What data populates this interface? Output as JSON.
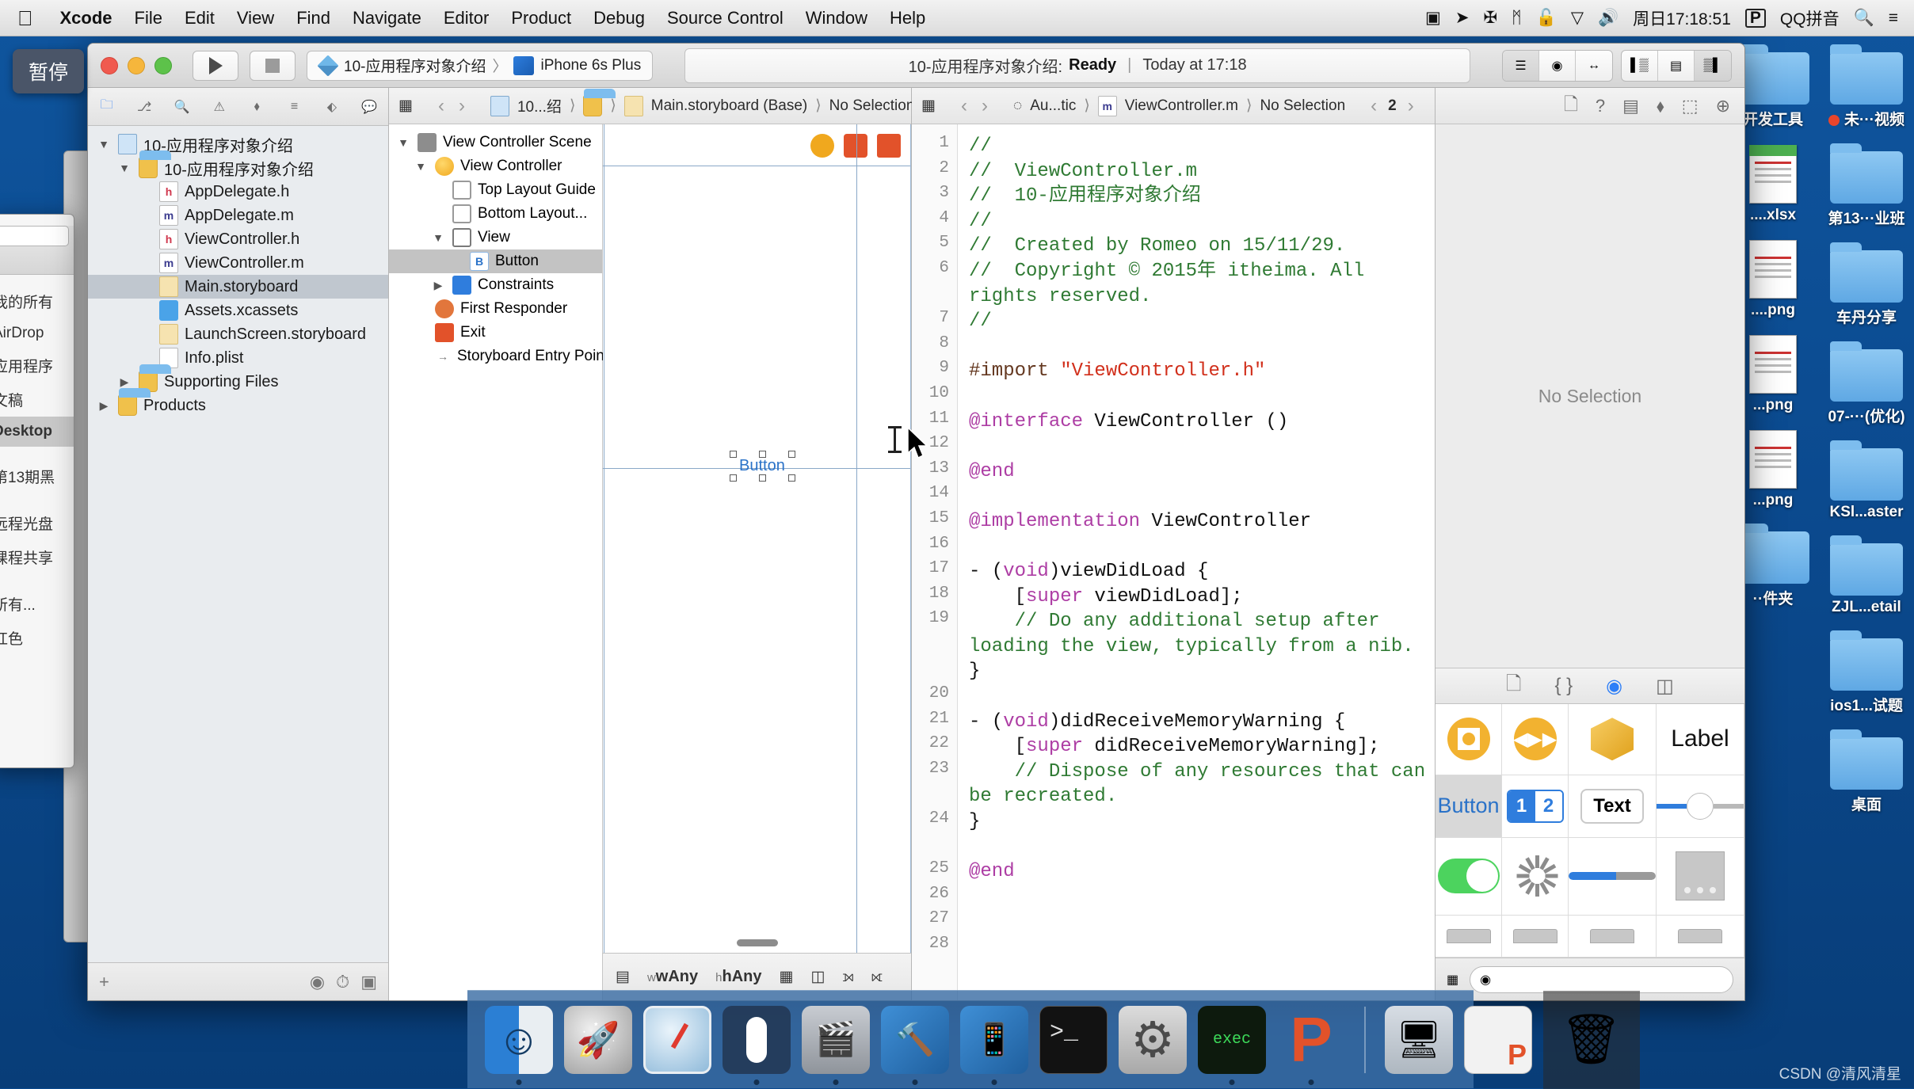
{
  "menubar": {
    "apple_icon": "apple-icon",
    "items": [
      {
        "label": "Xcode",
        "bold": true
      },
      {
        "label": "File",
        "bold": false
      },
      {
        "label": "Edit",
        "bold": false
      },
      {
        "label": "View",
        "bold": false
      },
      {
        "label": "Find",
        "bold": false
      },
      {
        "label": "Navigate",
        "bold": false
      },
      {
        "label": "Editor",
        "bold": false
      },
      {
        "label": "Product",
        "bold": false
      },
      {
        "label": "Debug",
        "bold": false
      },
      {
        "label": "Source Control",
        "bold": false
      },
      {
        "label": "Window",
        "bold": false
      },
      {
        "label": "Help",
        "bold": false
      }
    ],
    "status_items": [
      {
        "name": "screen-recording-icon",
        "glyph": "▣"
      },
      {
        "name": "location-arrow-icon",
        "glyph": "➤"
      },
      {
        "name": "airplay-icon",
        "glyph": "✠"
      },
      {
        "name": "bluetooth-icon",
        "glyph": "ᛗ"
      },
      {
        "name": "lock-icon",
        "glyph": "🔓"
      },
      {
        "name": "wifi-icon",
        "glyph": "▽"
      },
      {
        "name": "volume-icon",
        "glyph": "🔊"
      }
    ],
    "clock": "周日17:18:51",
    "input_badge": "P",
    "input_method": "QQ拼音",
    "spotlight_icon": "search-icon",
    "notification_icon": "list-icon"
  },
  "tooltip": {
    "text": "暂停"
  },
  "toolbar": {
    "run_icon": "play-icon",
    "stop_icon": "stop-icon",
    "scheme_name": "10-应用程序对象介绍",
    "scheme_sep": "〉",
    "destination": "iPhone 6s Plus",
    "status_project": "10-应用程序对象介绍:",
    "status_state": "Ready",
    "status_sep": "|",
    "status_time": "Today at 17:18"
  },
  "navigator": {
    "tabs": [
      {
        "name": "project-navigator-tab",
        "glyph": "🗀",
        "active": true
      },
      {
        "name": "source-control-navigator-tab",
        "glyph": "⎇",
        "active": false
      },
      {
        "name": "find-navigator-tab",
        "glyph": "🔍",
        "active": false
      },
      {
        "name": "issue-navigator-tab",
        "glyph": "⚠",
        "active": false
      },
      {
        "name": "test-navigator-tab",
        "glyph": "⬧",
        "active": false
      },
      {
        "name": "debug-navigator-tab",
        "glyph": "≡",
        "active": false
      },
      {
        "name": "breakpoint-navigator-tab",
        "glyph": "⬖",
        "active": false
      },
      {
        "name": "report-navigator-tab",
        "glyph": "💬",
        "active": false
      }
    ],
    "tree": [
      {
        "label": "10-应用程序对象介绍",
        "indent": 0,
        "twisty": "▼",
        "icon": "proj",
        "selected": false
      },
      {
        "label": "10-应用程序对象介绍",
        "indent": 1,
        "twisty": "▼",
        "icon": "folder",
        "selected": false
      },
      {
        "label": "AppDelegate.h",
        "indent": 2,
        "twisty": "",
        "icon": "h",
        "badge": "h",
        "selected": false
      },
      {
        "label": "AppDelegate.m",
        "indent": 2,
        "twisty": "",
        "icon": "m",
        "badge": "m",
        "selected": false
      },
      {
        "label": "ViewController.h",
        "indent": 2,
        "twisty": "",
        "icon": "h",
        "badge": "h",
        "selected": false
      },
      {
        "label": "ViewController.m",
        "indent": 2,
        "twisty": "",
        "icon": "m",
        "badge": "m",
        "selected": false
      },
      {
        "label": "Main.storyboard",
        "indent": 2,
        "twisty": "",
        "icon": "sb",
        "badge": "",
        "selected": true
      },
      {
        "label": "Assets.xcassets",
        "indent": 2,
        "twisty": "",
        "icon": "xcassets",
        "badge": "",
        "selected": false
      },
      {
        "label": "LaunchScreen.storyboard",
        "indent": 2,
        "twisty": "",
        "icon": "sb",
        "badge": "",
        "selected": false
      },
      {
        "label": "Info.plist",
        "indent": 2,
        "twisty": "",
        "icon": "plist",
        "badge": "",
        "selected": false
      },
      {
        "label": "Supporting Files",
        "indent": 1,
        "twisty": "▶",
        "icon": "folder",
        "selected": false
      },
      {
        "label": "Products",
        "indent": 0,
        "twisty": "▶",
        "icon": "folder",
        "selected": false
      }
    ],
    "footer_add": "+",
    "footer_filter_icon": "filter-icon"
  },
  "storyboard_editor": {
    "jumpbar": {
      "grid_icon": "grid-icon",
      "back": "‹",
      "forward": "›",
      "crumbs": [
        "10...绍",
        "",
        "Main.storyboard (Base)",
        "No Selection"
      ]
    },
    "outline": [
      {
        "label": "View Controller Scene",
        "indent": 0,
        "twisty": "▼",
        "icon": "scene",
        "selected": false
      },
      {
        "label": "View Controller",
        "indent": 1,
        "twisty": "▼",
        "icon": "vc",
        "selected": false
      },
      {
        "label": "Top Layout Guide",
        "indent": 2,
        "twisty": "",
        "icon": "guide",
        "selected": false
      },
      {
        "label": "Bottom Layout...",
        "indent": 2,
        "twisty": "",
        "icon": "guide",
        "selected": false
      },
      {
        "label": "View",
        "indent": 2,
        "twisty": "▼",
        "icon": "view",
        "selected": false
      },
      {
        "label": "Button",
        "indent": 3,
        "twisty": "",
        "icon": "btn",
        "selected": true
      },
      {
        "label": "Constraints",
        "indent": 2,
        "twisty": "▶",
        "icon": "cons",
        "selected": false
      },
      {
        "label": "First Responder",
        "indent": 1,
        "twisty": "",
        "icon": "fr",
        "selected": false
      },
      {
        "label": "Exit",
        "indent": 1,
        "twisty": "",
        "icon": "exit",
        "selected": false
      },
      {
        "label": "Storyboard Entry Point",
        "indent": 1,
        "twisty": "",
        "icon": "arrow",
        "selected": false
      }
    ],
    "canvas": {
      "button_label": "Button",
      "size_class_w": "wAny",
      "size_class_w_prefix": "w",
      "size_class_h": "hAny",
      "size_class_h_prefix": "h",
      "bottom_icons": [
        "panel-icon",
        "constraints-icon",
        "align-icon",
        "pin-icon",
        "resolve-icon"
      ]
    }
  },
  "code_editor": {
    "jumpbar": {
      "grid_icon": "grid-icon",
      "back": "‹",
      "forward": "›",
      "related_icon": "related-items-icon",
      "crumbs": [
        "Au...tic",
        "ViewController.m",
        "No Selection"
      ],
      "counter_prev": "‹",
      "counter": "2",
      "counter_next": "›",
      "add": "+",
      "close": "✕"
    },
    "lines": [
      {
        "n": 1,
        "tokens": [
          {
            "t": "//",
            "c": "cm"
          }
        ]
      },
      {
        "n": 2,
        "tokens": [
          {
            "t": "//  ViewController.m",
            "c": "cm"
          }
        ]
      },
      {
        "n": 3,
        "tokens": [
          {
            "t": "//  10-应用程序对象介绍",
            "c": "cm"
          }
        ]
      },
      {
        "n": 4,
        "tokens": [
          {
            "t": "//",
            "c": "cm"
          }
        ]
      },
      {
        "n": 5,
        "tokens": [
          {
            "t": "//  Created by Romeo on 15/11/29.",
            "c": "cm"
          }
        ]
      },
      {
        "n": 6,
        "tokens": [
          {
            "t": "//  Copyright © 2015年 itheima. All rights reserved.",
            "c": "cm"
          }
        ],
        "wrap": 1
      },
      {
        "n": 7,
        "tokens": [
          {
            "t": "//",
            "c": "cm"
          }
        ]
      },
      {
        "n": 8,
        "tokens": [
          {
            "t": "",
            "c": ""
          }
        ]
      },
      {
        "n": 9,
        "tokens": [
          {
            "t": "#import ",
            "c": "pp"
          },
          {
            "t": "\"ViewController.h\"",
            "c": "str"
          }
        ]
      },
      {
        "n": 10,
        "tokens": [
          {
            "t": "",
            "c": ""
          }
        ]
      },
      {
        "n": 11,
        "tokens": [
          {
            "t": "@interface",
            "c": "kw"
          },
          {
            "t": " ViewController ()",
            "c": ""
          }
        ]
      },
      {
        "n": 12,
        "tokens": [
          {
            "t": "",
            "c": ""
          }
        ]
      },
      {
        "n": 13,
        "tokens": [
          {
            "t": "@end",
            "c": "kw"
          }
        ]
      },
      {
        "n": 14,
        "tokens": [
          {
            "t": "",
            "c": ""
          }
        ]
      },
      {
        "n": 15,
        "tokens": [
          {
            "t": "@implementation",
            "c": "kw"
          },
          {
            "t": " ViewController",
            "c": ""
          }
        ]
      },
      {
        "n": 16,
        "tokens": [
          {
            "t": "",
            "c": ""
          }
        ]
      },
      {
        "n": 17,
        "tokens": [
          {
            "t": "- (",
            "c": ""
          },
          {
            "t": "void",
            "c": "kw"
          },
          {
            "t": ")viewDidLoad {",
            "c": ""
          }
        ]
      },
      {
        "n": 18,
        "tokens": [
          {
            "t": "    [",
            "c": ""
          },
          {
            "t": "super",
            "c": "kw"
          },
          {
            "t": " viewDidLoad];",
            "c": ""
          }
        ]
      },
      {
        "n": 19,
        "tokens": [
          {
            "t": "    // Do any additional setup after loading the view, typically from a nib.",
            "c": "cm"
          }
        ],
        "wrap": 2
      },
      {
        "n": 20,
        "tokens": [
          {
            "t": "}",
            "c": ""
          }
        ]
      },
      {
        "n": 21,
        "tokens": [
          {
            "t": "",
            "c": ""
          }
        ]
      },
      {
        "n": 22,
        "tokens": [
          {
            "t": "- (",
            "c": ""
          },
          {
            "t": "void",
            "c": "kw"
          },
          {
            "t": ")didReceiveMemoryWarning {",
            "c": ""
          }
        ]
      },
      {
        "n": 23,
        "tokens": [
          {
            "t": "    [",
            "c": ""
          },
          {
            "t": "super",
            "c": "kw"
          },
          {
            "t": " didReceiveMemoryWarning];",
            "c": ""
          }
        ],
        "wrap": 1
      },
      {
        "n": 24,
        "tokens": [
          {
            "t": "    // Dispose of any resources that can be recreated.",
            "c": "cm"
          }
        ],
        "wrap": 1
      },
      {
        "n": 25,
        "tokens": [
          {
            "t": "}",
            "c": ""
          }
        ]
      },
      {
        "n": 26,
        "tokens": [
          {
            "t": "",
            "c": ""
          }
        ]
      },
      {
        "n": 27,
        "tokens": [
          {
            "t": "@end",
            "c": "kw"
          }
        ]
      },
      {
        "n": 28,
        "tokens": [
          {
            "t": "",
            "c": ""
          }
        ]
      }
    ]
  },
  "utilities": {
    "inspector_tabs": [
      {
        "name": "file-inspector-tab",
        "glyph": "🗋"
      },
      {
        "name": "quick-help-inspector-tab",
        "glyph": "?"
      },
      {
        "name": "identity-inspector-tab",
        "glyph": "▤"
      },
      {
        "name": "attributes-inspector-tab",
        "glyph": "⬧"
      },
      {
        "name": "size-inspector-tab",
        "glyph": "⬚"
      },
      {
        "name": "connections-inspector-tab",
        "glyph": "⊕"
      }
    ],
    "no_selection": "No Selection",
    "library_tabs": [
      {
        "name": "file-template-library-tab",
        "glyph": "🗋",
        "active": false
      },
      {
        "name": "code-snippet-library-tab",
        "glyph": "{ }",
        "active": false
      },
      {
        "name": "object-library-tab",
        "glyph": "◉",
        "active": true
      },
      {
        "name": "media-library-tab",
        "glyph": "◫",
        "active": false
      }
    ],
    "library_items": [
      {
        "name": "view-controller-object",
        "kind": "obj",
        "label": ""
      },
      {
        "name": "storyboard-reference-object",
        "kind": "media",
        "label": ""
      },
      {
        "name": "object-cube",
        "kind": "cube",
        "label": ""
      },
      {
        "name": "label-object",
        "kind": "label",
        "label": "Label"
      },
      {
        "name": "button-object",
        "kind": "button",
        "label": "Button",
        "selected": true
      },
      {
        "name": "segmented-control-object",
        "kind": "segmented",
        "label": "1 2"
      },
      {
        "name": "text-field-object",
        "kind": "text",
        "label": "Text"
      },
      {
        "name": "slider-object",
        "kind": "slider",
        "label": ""
      },
      {
        "name": "switch-object",
        "kind": "switch",
        "label": ""
      },
      {
        "name": "activity-indicator-object",
        "kind": "spinner",
        "label": ""
      },
      {
        "name": "progress-view-object",
        "kind": "progress",
        "label": ""
      },
      {
        "name": "page-control-object",
        "kind": "page",
        "label": ""
      },
      {
        "name": "stepper-object",
        "kind": "partial",
        "label": ""
      },
      {
        "name": "horizontal-stack-object",
        "kind": "partial",
        "label": ""
      },
      {
        "name": "vertical-stack-object",
        "kind": "partial",
        "label": ""
      },
      {
        "name": "table-view-object",
        "kind": "partial",
        "label": ""
      }
    ],
    "search_placeholder": ""
  },
  "finder_background": {
    "sidebar_items": [
      {
        "label": "我的所有",
        "selected": false
      },
      {
        "label": "AirDrop",
        "selected": false
      },
      {
        "label": "应用程序",
        "selected": false
      },
      {
        "label": "文稿",
        "selected": false
      },
      {
        "label": "Desktop",
        "selected": true
      },
      {
        "label": "第13期黑",
        "selected": false
      },
      {
        "label": "远程光盘",
        "selected": false
      },
      {
        "label": "课程共享",
        "selected": false
      },
      {
        "label": "所有...",
        "selected": false
      },
      {
        "label": "红色",
        "selected": false
      }
    ]
  },
  "desktop_icons": {
    "left_column": [
      {
        "label": "开发工具",
        "kind": "folder"
      },
      {
        "label": "....xlsx",
        "kind": "xls"
      },
      {
        "label": "....png",
        "kind": "png"
      },
      {
        "label": "...png",
        "kind": "png"
      },
      {
        "label": "...png",
        "kind": "png"
      },
      {
        "label": "··件夹",
        "kind": "folder"
      }
    ],
    "right_column": [
      {
        "label": "未···视频",
        "kind": "folder",
        "rec_dot": true
      },
      {
        "label": "第13···业班",
        "kind": "folder"
      },
      {
        "label": "车丹分享",
        "kind": "folder"
      },
      {
        "label": "07-···(优化)",
        "kind": "folder"
      },
      {
        "label": "KSl...aster",
        "kind": "folder"
      },
      {
        "label": "ZJL...etail",
        "kind": "folder"
      },
      {
        "label": "ios1...试题",
        "kind": "folder"
      },
      {
        "label": "桌面",
        "kind": "folder"
      }
    ]
  },
  "dock": {
    "items": [
      {
        "name": "dock-finder",
        "cls": "ico-finder",
        "running": true
      },
      {
        "name": "dock-launchpad",
        "cls": "ico-launch",
        "running": false
      },
      {
        "name": "dock-safari",
        "cls": "ico-safari",
        "running": false
      },
      {
        "name": "dock-mouse-app",
        "cls": "ico-mouse",
        "running": true
      },
      {
        "name": "dock-quicktime",
        "cls": "ico-qt",
        "running": true
      },
      {
        "name": "dock-xcode",
        "cls": "ico-xcode",
        "running": true
      },
      {
        "name": "dock-xcode-simulator",
        "cls": "ico-xcode2",
        "running": true
      },
      {
        "name": "dock-terminal",
        "cls": "ico-term",
        "running": false
      },
      {
        "name": "dock-system-preferences",
        "cls": "ico-prefs",
        "running": false
      },
      {
        "name": "dock-exec",
        "cls": "ico-exec",
        "running": true
      },
      {
        "name": "dock-parallels",
        "cls": "ico-p",
        "running": true
      }
    ],
    "recent": [
      {
        "name": "dock-screen-sharing",
        "cls": "ico-screen"
      },
      {
        "name": "dock-document",
        "cls": "ico-doc2"
      }
    ],
    "trash": {
      "name": "dock-trash",
      "cls": "ico-trash"
    }
  },
  "watermark": "CSDN @清风清星"
}
